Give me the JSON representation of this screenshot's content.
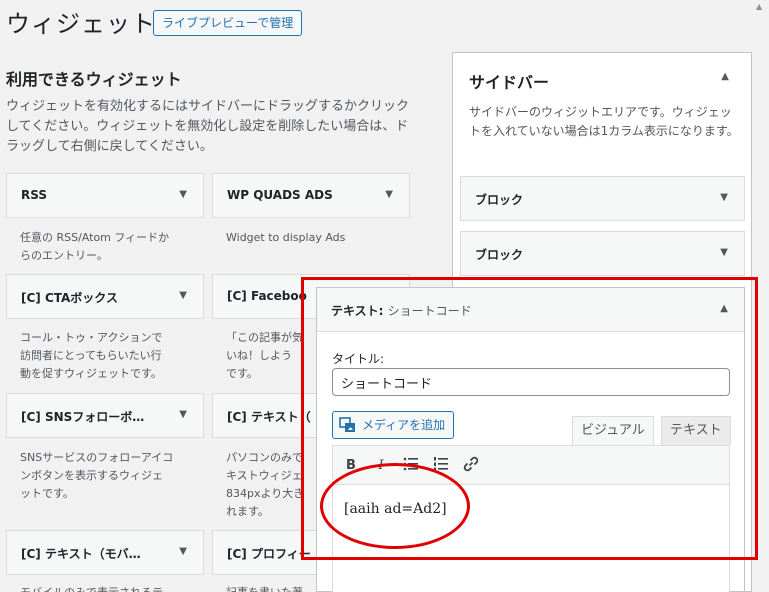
{
  "header": {
    "title": "ウィジェット",
    "preview_button": "ライブプレビューで管理"
  },
  "available": {
    "title": "利用できるウィジェット",
    "description": "ウィジェットを有効化するにはサイドバーにドラッグするかクリックしてください。ウィジェットを無効化し設定を削除したい場合は、ドラッグして右側に戻してください。",
    "widgets": [
      {
        "title": "RSS",
        "desc": "任意の RSS/Atom フィードか\nらのエントリー。"
      },
      {
        "title": "WP QUADS ADS",
        "desc": "Widget to display Ads"
      },
      {
        "title": "[C] CTAボックス",
        "desc": "コール・トゥ・アクションで\n訪問者にとってもらいたい行\n動を促すウィジェットです。"
      },
      {
        "title": "[C] Faceboo",
        "desc": "「この記事が気\nいね！しよう\nです。"
      },
      {
        "title": "[C] SNSフォローボ…",
        "desc": "SNSサービスのフォローアイコ\nンボタンを表示するウィジェ\nットです。"
      },
      {
        "title": "[C] テキスト（",
        "desc": "パソコンのみで\nキストウィジェ\n834pxより大き\nれます。"
      },
      {
        "title": "[C] テキスト（モバ…",
        "desc": "モバイルのみで表示されるテ"
      },
      {
        "title": "[C] プロフィー",
        "desc": "記事を書いた著"
      }
    ]
  },
  "sidebar": {
    "title": "サイドバー",
    "description": "サイドバーのウィジットエリアです。ウィジェットを入れていない場合は1カラム表示になります。",
    "blocks": [
      "ブロック",
      "ブロック"
    ]
  },
  "text_widget": {
    "header_label": "テキスト",
    "header_sep": ":",
    "header_subtitle": "ショートコード",
    "title_label": "タイトル:",
    "title_value": "ショートコード",
    "media_button": "メディアを追加",
    "tab_visual": "ビジュアル",
    "tab_text": "テキスト",
    "toolbar": {
      "bold": "B",
      "italic": "I"
    },
    "content": "[aaih ad=Ad2]"
  },
  "icons": {
    "arrow_down": "▼",
    "arrow_up": "▲"
  },
  "colors": {
    "accent": "#2271b1",
    "highlight": "#e00000"
  }
}
